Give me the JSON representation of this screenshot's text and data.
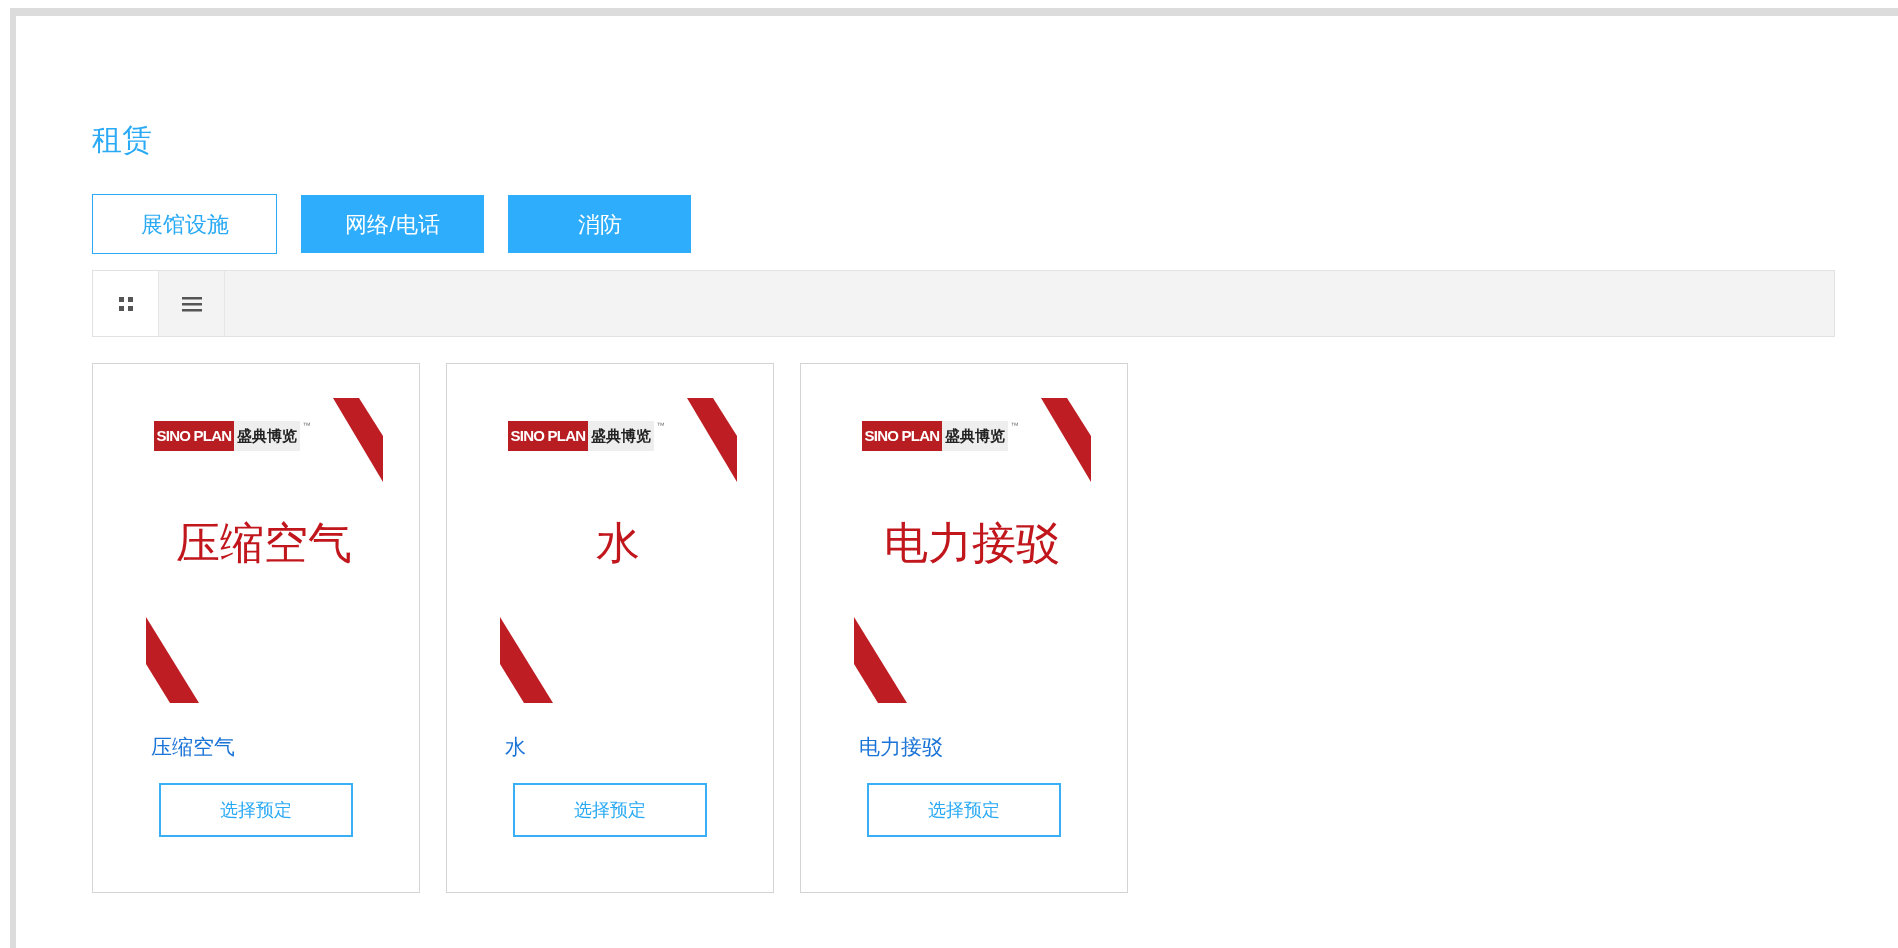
{
  "title": "租赁",
  "tabs": [
    {
      "label": "展馆设施",
      "selected": true
    },
    {
      "label": "网络/电话",
      "selected": false
    },
    {
      "label": "消防",
      "selected": false
    }
  ],
  "view_toggle": [
    {
      "kind": "grid",
      "selected": true
    },
    {
      "kind": "list",
      "selected": false
    }
  ],
  "products": [
    {
      "logo_text": "SINO PLAN",
      "logo_brand": "盛典博览",
      "logo_mark": "™",
      "image_title": "压缩空气",
      "name": "压缩空气",
      "button": "选择预定"
    },
    {
      "logo_text": "SINO PLAN",
      "logo_brand": "盛典博览",
      "logo_mark": "™",
      "image_title": "水",
      "name": "水",
      "button": "选择预定"
    },
    {
      "logo_text": "SINO PLAN",
      "logo_brand": "盛典博览",
      "logo_mark": "™",
      "image_title": "电力接驳",
      "name": "电力接驳",
      "button": "选择预定"
    }
  ]
}
